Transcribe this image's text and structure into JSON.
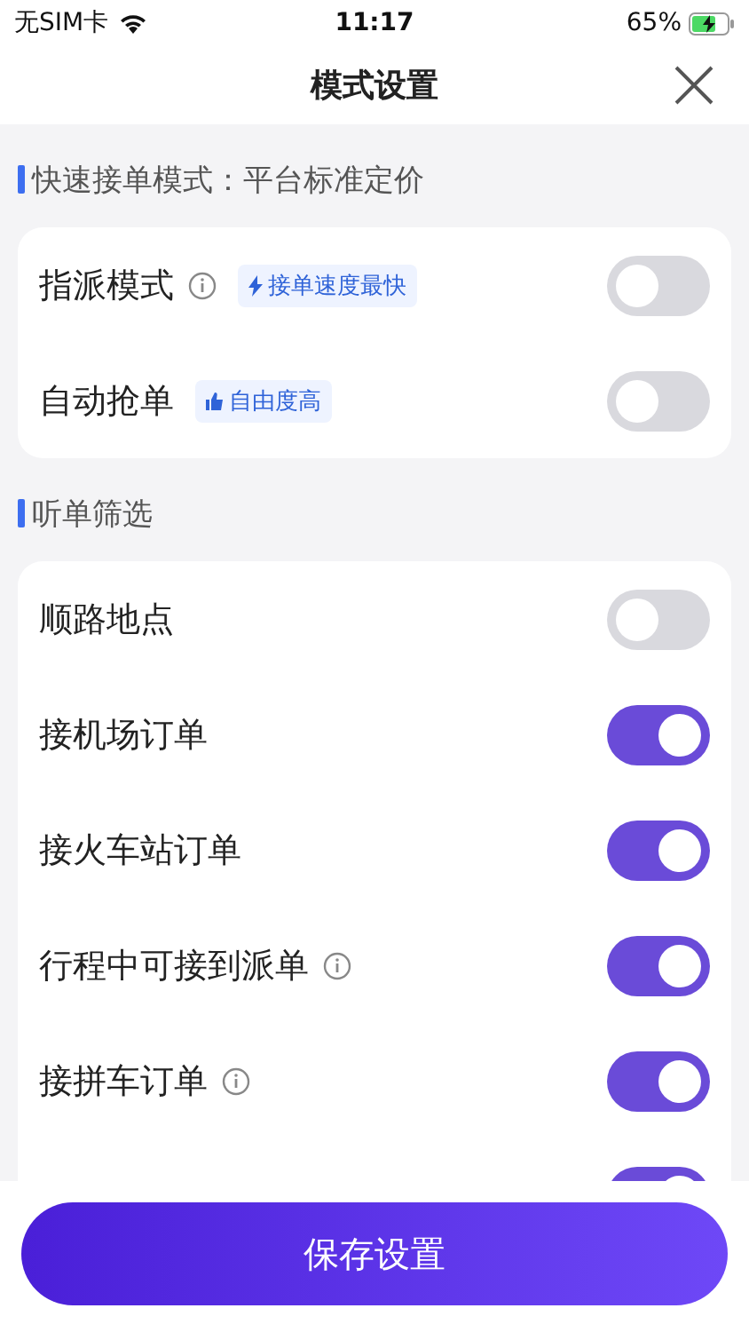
{
  "status_bar": {
    "carrier": "无SIM卡",
    "time": "11:17",
    "battery": "65%"
  },
  "header": {
    "title": "模式设置"
  },
  "sections": [
    {
      "title": "快速接单模式：平台标准定价",
      "rows": [
        {
          "label": "指派模式",
          "info": true,
          "tag": {
            "kind": "bolt",
            "text": "接单速度最快"
          },
          "on": false
        },
        {
          "label": "自动抢单",
          "info": false,
          "tag": {
            "kind": "thumb",
            "text": "自由度高"
          },
          "on": false
        }
      ]
    },
    {
      "title": "听单筛选",
      "rows": [
        {
          "label": "顺路地点",
          "info": false,
          "on": false
        },
        {
          "label": "接机场订单",
          "info": false,
          "on": true
        },
        {
          "label": "接火车站订单",
          "info": false,
          "on": true
        },
        {
          "label": "行程中可接到派单",
          "info": true,
          "on": true
        },
        {
          "label": "接拼车订单",
          "info": true,
          "on": true
        },
        {
          "info": false,
          "on": true
        }
      ]
    }
  ],
  "save_button": "保存设置"
}
